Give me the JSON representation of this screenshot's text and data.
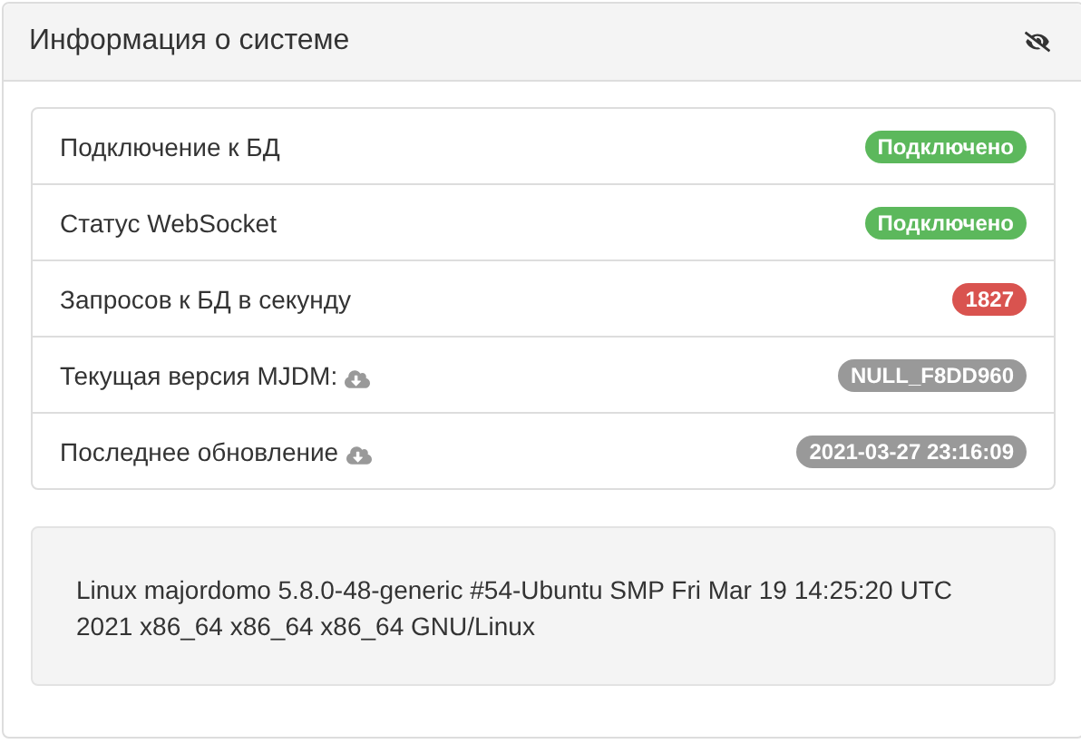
{
  "panel": {
    "title": "Информация о системе"
  },
  "items": [
    {
      "label": "Подключение к БД",
      "update_icon": false,
      "badge": "Подключено",
      "color": "#5cb85c"
    },
    {
      "label": "Статус WebSocket",
      "update_icon": false,
      "badge": "Подключено",
      "color": "#5cb85c"
    },
    {
      "label": "Запросов к БД в секунду",
      "update_icon": false,
      "badge": "1827",
      "color": "#d9534f"
    },
    {
      "label": "Текущая версия MJDM:",
      "update_icon": true,
      "badge": "NULL_F8DD960",
      "color": "#999999"
    },
    {
      "label": "Последнее обновление",
      "update_icon": true,
      "badge": "2021-03-27 23:16:09",
      "color": "#999999"
    }
  ],
  "system_info": "Linux majordomo 5.8.0-48-generic #54-Ubuntu SMP Fri Mar 19 14:25:20 UTC 2021 x86_64 x86_64 x86_64 GNU/Linux"
}
